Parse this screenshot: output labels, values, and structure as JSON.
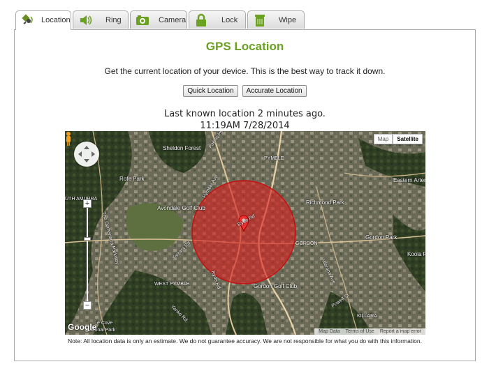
{
  "tabs": [
    {
      "label": "Location",
      "icon": "location-icon",
      "active": true
    },
    {
      "label": "Ring",
      "icon": "speaker-icon",
      "active": false
    },
    {
      "label": "Camera",
      "icon": "camera-icon",
      "active": false
    },
    {
      "label": "Lock",
      "icon": "lock-icon",
      "active": false
    },
    {
      "label": "Wipe",
      "icon": "trash-icon",
      "active": false
    }
  ],
  "page": {
    "title": "GPS Location",
    "description": "Get the current location of your device. This is the best way to track it down.",
    "quick_button": "Quick Location",
    "accurate_button": "Accurate Location",
    "last_known": "Last known location 2 minutes ago.",
    "timestamp": "11:19AM 7/28/2014",
    "note": "Note: All location data is only an estimate. We do not guarantee accuracy. We are not responsible for what you do with this information."
  },
  "map": {
    "type_map": "Map",
    "type_satellite": "Satellite",
    "selected_type": "Satellite",
    "zoom_in": "+",
    "zoom_out": "−",
    "logo": "Google",
    "attr_data": "Map Data",
    "attr_terms": "Terms of Use",
    "attr_report": "Report a map error",
    "labels": {
      "sheldon_forest": "Sheldon Forest",
      "pymble": "PYMBLE",
      "pacific_hwy": "Pacific Hwy",
      "rofe_park": "Rofe Park",
      "avondale": "Avondale Golf Club",
      "richmond_park": "Richmond Park",
      "gordon_park": "Gordon Park",
      "eastern_arterial": "Eastern Arter",
      "koola": "Koola P",
      "gordon": "GORDON",
      "west_pymble": "WEST PYMBLE",
      "gordon_golf": "Gordon Golf Club",
      "killara": "KILLARA",
      "yanko": "Yanko Rd",
      "ryde_rd": "Ryde Rd",
      "powell": "Powell St",
      "werona": "Werona Ave",
      "yarrara": "Yarrara Rd",
      "cove": "e Cove",
      "national_park": "National Park",
      "south_turramurra": "UTH AMURRA",
      "comenarra": "The Comenarra Parkway",
      "pymble_ave": "Pymble Ave",
      "livingstone": "Ryde Rd"
    },
    "accuracy_color": "#d81e1e"
  }
}
